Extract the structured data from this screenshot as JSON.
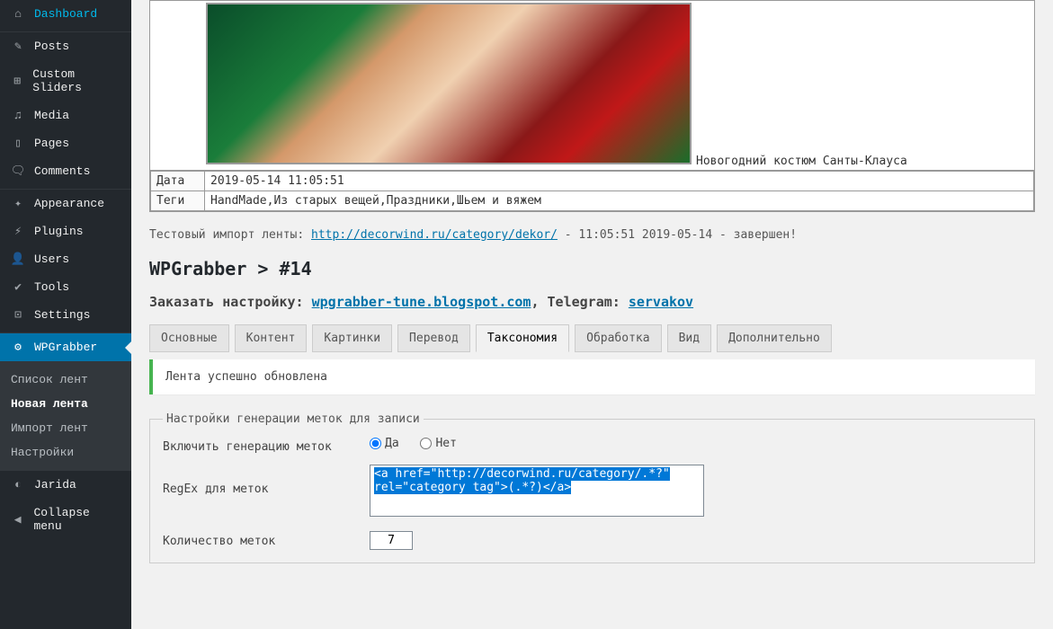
{
  "sidebar": {
    "items": [
      {
        "icon": "⌂",
        "label": "Dashboard"
      },
      {
        "icon": "✎",
        "label": "Posts"
      },
      {
        "icon": "⊞",
        "label": "Custom Sliders"
      },
      {
        "icon": "♫",
        "label": "Media"
      },
      {
        "icon": "▯",
        "label": "Pages"
      },
      {
        "icon": "🗨",
        "label": "Comments"
      }
    ],
    "items2": [
      {
        "icon": "✦",
        "label": "Appearance"
      },
      {
        "icon": "⚡",
        "label": "Plugins"
      },
      {
        "icon": "👤",
        "label": "Users"
      },
      {
        "icon": "✔",
        "label": "Tools"
      },
      {
        "icon": "⊡",
        "label": "Settings"
      }
    ],
    "wpgrabber": {
      "icon": "⚙",
      "label": "WPGrabber",
      "submenu": [
        "Список лент",
        "Новая лента",
        "Импорт лент",
        "Настройки"
      ]
    },
    "jarida": {
      "icon": "◐",
      "label": "Jarida"
    },
    "collapse": {
      "icon": "◀",
      "label": "Collapse menu"
    }
  },
  "import": {
    "caption": "Новогодний костюм Санты-Клауса",
    "date_key": "Дата",
    "date_val": "2019-05-14 11:05:51",
    "tags_key": "Теги",
    "tags_val": "HandMade,Из старых вещей,Праздники,Шьем и вяжем",
    "summary_pre": "Тестовый импорт ленты: ",
    "summary_link": "http://decorwind.ru/category/dekor/",
    "summary_post": " - 11:05:51 2019-05-14 - завершен!"
  },
  "heading": "WPGrabber > #14",
  "order": {
    "prefix": "Заказать настройку: ",
    "link1": "wpgrabber-tune.blogspot.com",
    "mid": ", Telegram: ",
    "link2": "servakov"
  },
  "tabs": [
    "Основные",
    "Контент",
    "Картинки",
    "Перевод",
    "Таксономия",
    "Обработка",
    "Вид",
    "Дополнительно"
  ],
  "active_tab": 4,
  "notice": "Лента успешно обновлена",
  "fieldset": {
    "legend": "Настройки генерации меток для записи",
    "enable_label": "Включить генерацию меток",
    "yes": "Да",
    "no": "Нет",
    "regex_label": "RegEx для меток",
    "regex_value": "<a href=\"http://decorwind.ru/category/.*?\" rel=\"category tag\">(.*?)</a>",
    "count_label": "Количество меток",
    "count_value": "7"
  }
}
